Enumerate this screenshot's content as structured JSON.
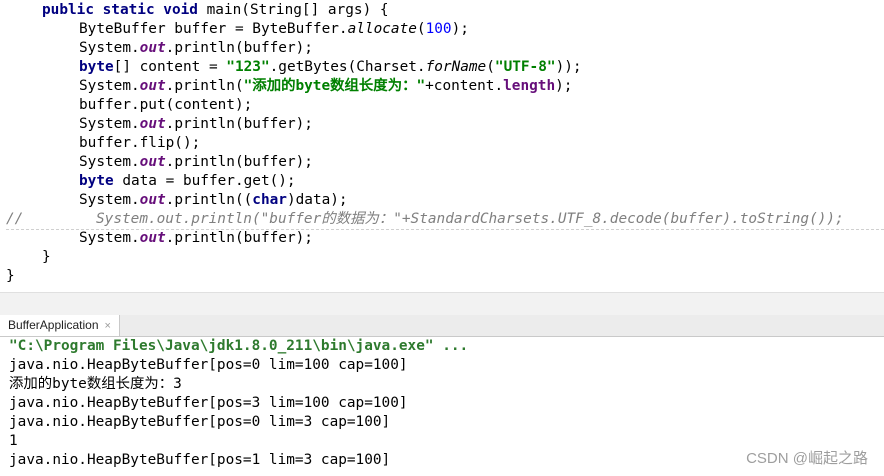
{
  "editor": {
    "line1_kw": "public static void ",
    "line1_rest": "main(String[] args) {",
    "line2_a": "ByteBuffer buffer = ByteBuffer.",
    "line2_method": "allocate",
    "line2_open": "(",
    "line2_num": "100",
    "line2_close": ");",
    "line3_a": "System.",
    "line3_out": "out",
    "line3_b": ".println(buffer);",
    "line4_kw": "byte",
    "line4_a": "[] content = ",
    "line4_str": "\"123\"",
    "line4_b": ".getBytes(Charset.",
    "line4_method": "forName",
    "line4_c": "(",
    "line4_str2": "\"UTF-8\"",
    "line4_d": "));",
    "line5_a": "System.",
    "line5_out": "out",
    "line5_b": ".println(",
    "line5_str": "\"添加的byte数组长度为：\"",
    "line5_c": "+content.",
    "line5_field": "length",
    "line5_d": ");",
    "line6": "buffer.put(content);",
    "line7_a": "System.",
    "line7_out": "out",
    "line7_b": ".println(buffer);",
    "line8": "buffer.flip();",
    "line9_a": "System.",
    "line9_out": "out",
    "line9_b": ".println(buffer);",
    "line10_kw": "byte",
    "line10_a": " data = buffer.get();",
    "line11_a": "System.",
    "line11_out": "out",
    "line11_b": ".println((",
    "line11_kw": "char",
    "line11_c": ")data);",
    "line12_slashes": "//",
    "line12_comment": "System.out.println(\"buffer的数据为：\"+StandardCharsets.UTF_8.decode(buffer).toString());",
    "line13_a": "System.",
    "line13_out": "out",
    "line13_b": ".println(buffer);",
    "line14": "}",
    "line15": "}"
  },
  "run_panel": {
    "tab_label": "BufferApplication",
    "tab_close": "×"
  },
  "console": {
    "command": "\"C:\\Program Files\\Java\\jdk1.8.0_211\\bin\\java.exe\" ...",
    "out1": "java.nio.HeapByteBuffer[pos=0 lim=100 cap=100]",
    "out2": "添加的byte数组长度为：3",
    "out3": "java.nio.HeapByteBuffer[pos=3 lim=100 cap=100]",
    "out4": "java.nio.HeapByteBuffer[pos=0 lim=3 cap=100]",
    "out5": "1",
    "out6": "java.nio.HeapByteBuffer[pos=1 lim=3 cap=100]"
  },
  "watermark": "CSDN @崛起之路"
}
